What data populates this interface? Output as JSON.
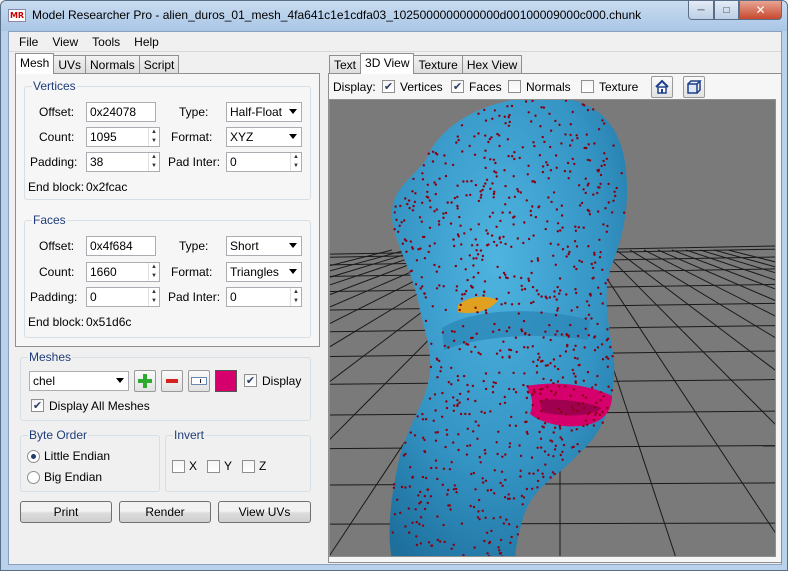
{
  "window": {
    "app_icon": "MR",
    "title": "Model Researcher Pro - alien_duros_01_mesh_4fa641c1e1cdfa03_1025000000000000d00100009000c000.chunk",
    "buttons": {
      "minimize": "minimize-icon",
      "maximize": "maximize-icon",
      "close": "close-icon"
    }
  },
  "menu": [
    "File",
    "View",
    "Tools",
    "Help"
  ],
  "left_tabs": [
    "Mesh",
    "UVs",
    "Normals",
    "Script"
  ],
  "vertices": {
    "title": "Vertices",
    "offset_label": "Offset:",
    "offset": "0x24078",
    "type_label": "Type:",
    "type": "Half-Float",
    "count_label": "Count:",
    "count": "1095",
    "format_label": "Format:",
    "format": "XYZ",
    "padding_label": "Padding:",
    "padding": "38",
    "padinter_label": "Pad Inter:",
    "padinter": "0",
    "endblock_label": "End block:",
    "endblock": "0x2fcac"
  },
  "faces": {
    "title": "Faces",
    "offset_label": "Offset:",
    "offset": "0x4f684",
    "type_label": "Type:",
    "type": "Short",
    "count_label": "Count:",
    "count": "1660",
    "format_label": "Format:",
    "format": "Triangles",
    "padding_label": "Padding:",
    "padding": "0",
    "padinter_label": "Pad Inter:",
    "padinter": "0",
    "endblock_label": "End block:",
    "endblock": "0x51d6c"
  },
  "meshes": {
    "title": "Meshes",
    "selected": "chel",
    "color": "#d5006b",
    "display_label": "Display",
    "display_checked": true,
    "display_all_label": "Display All Meshes",
    "display_all_checked": true
  },
  "byte_order": {
    "title": "Byte Order",
    "options": [
      "Little Endian",
      "Big Endian"
    ],
    "selected": "Little Endian"
  },
  "invert": {
    "title": "Invert",
    "axes": [
      "X",
      "Y",
      "Z"
    ]
  },
  "buttons": {
    "print": "Print",
    "render": "Render",
    "view_uvs": "View UVs"
  },
  "right_tabs": [
    "Text",
    "3D View",
    "Texture",
    "Hex View"
  ],
  "display": {
    "label": "Display:",
    "vertices": "Vertices",
    "vertices_checked": true,
    "faces": "Faces",
    "faces_checked": true,
    "normals": "Normals",
    "normals_checked": false,
    "texture": "Texture",
    "texture_checked": false,
    "home_icon": "home-icon",
    "cube_icon": "cube-view-icon"
  },
  "viewport": {
    "background": "#7a7a7a",
    "mesh_color": "#3a9bc8",
    "vertex_color": "#8a0010",
    "grid_color": "#1a1a1a"
  }
}
